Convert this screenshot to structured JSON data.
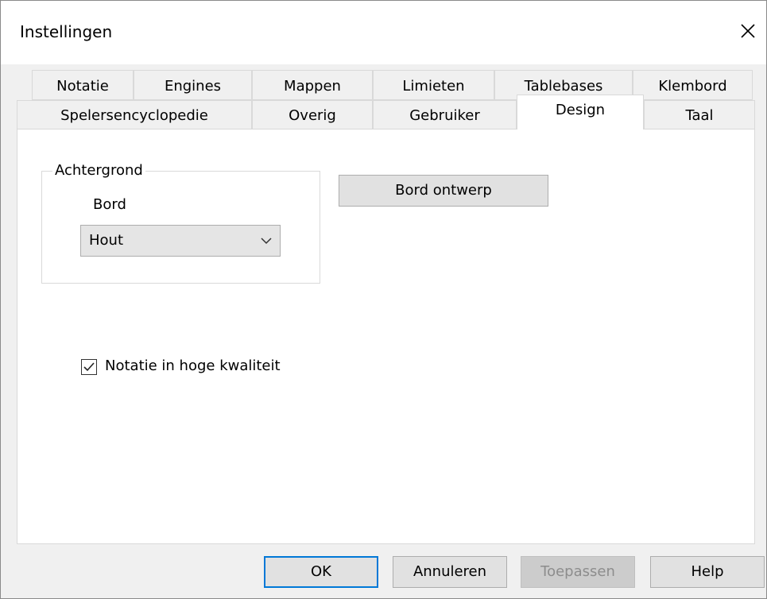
{
  "window": {
    "title": "Instellingen"
  },
  "tabs": {
    "row1": [
      "Notatie",
      "Engines",
      "Mappen",
      "Limieten",
      "Tablebases",
      "Klembord"
    ],
    "row2": [
      "Spelersencyclopedie",
      "Overig",
      "Gebruiker",
      "Design",
      "Taal"
    ],
    "active": "Design"
  },
  "design": {
    "background_group": "Achtergrond",
    "board_label": "Bord",
    "board_value": "Hout",
    "board_design_button": "Bord ontwerp",
    "high_quality_notation": {
      "label": "Notatie in hoge kwaliteit",
      "checked": true
    }
  },
  "buttons": {
    "ok": "OK",
    "cancel": "Annuleren",
    "apply": "Toepassen",
    "help": "Help"
  },
  "icons": {
    "close": "close-icon",
    "dropdown": "chevron-down-icon",
    "check": "check-icon"
  }
}
